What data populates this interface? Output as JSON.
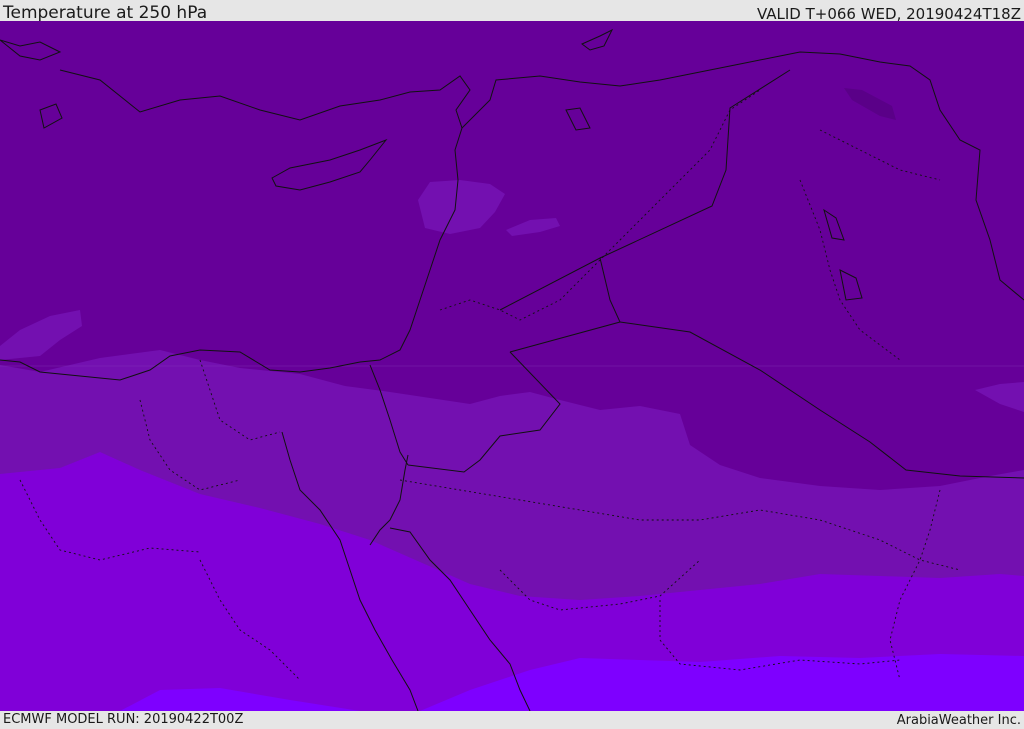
{
  "header": {
    "title": "Temperature at 250 hPa",
    "valid": "VALID T+066 WED, 20190424T18Z"
  },
  "footer": {
    "model_run": "ECMWF MODEL RUN: 20190422T00Z",
    "credit": "ArabiaWeather Inc."
  },
  "palette": {
    "band_darkest": "#5a0088",
    "band_dark": "#660099",
    "band_mid": "#7310b0",
    "band_light": "#8000d8",
    "band_lightest": "#7e00ff",
    "border": "#111111"
  },
  "icons": [
    "coastline-lines",
    "country-border-lines"
  ]
}
